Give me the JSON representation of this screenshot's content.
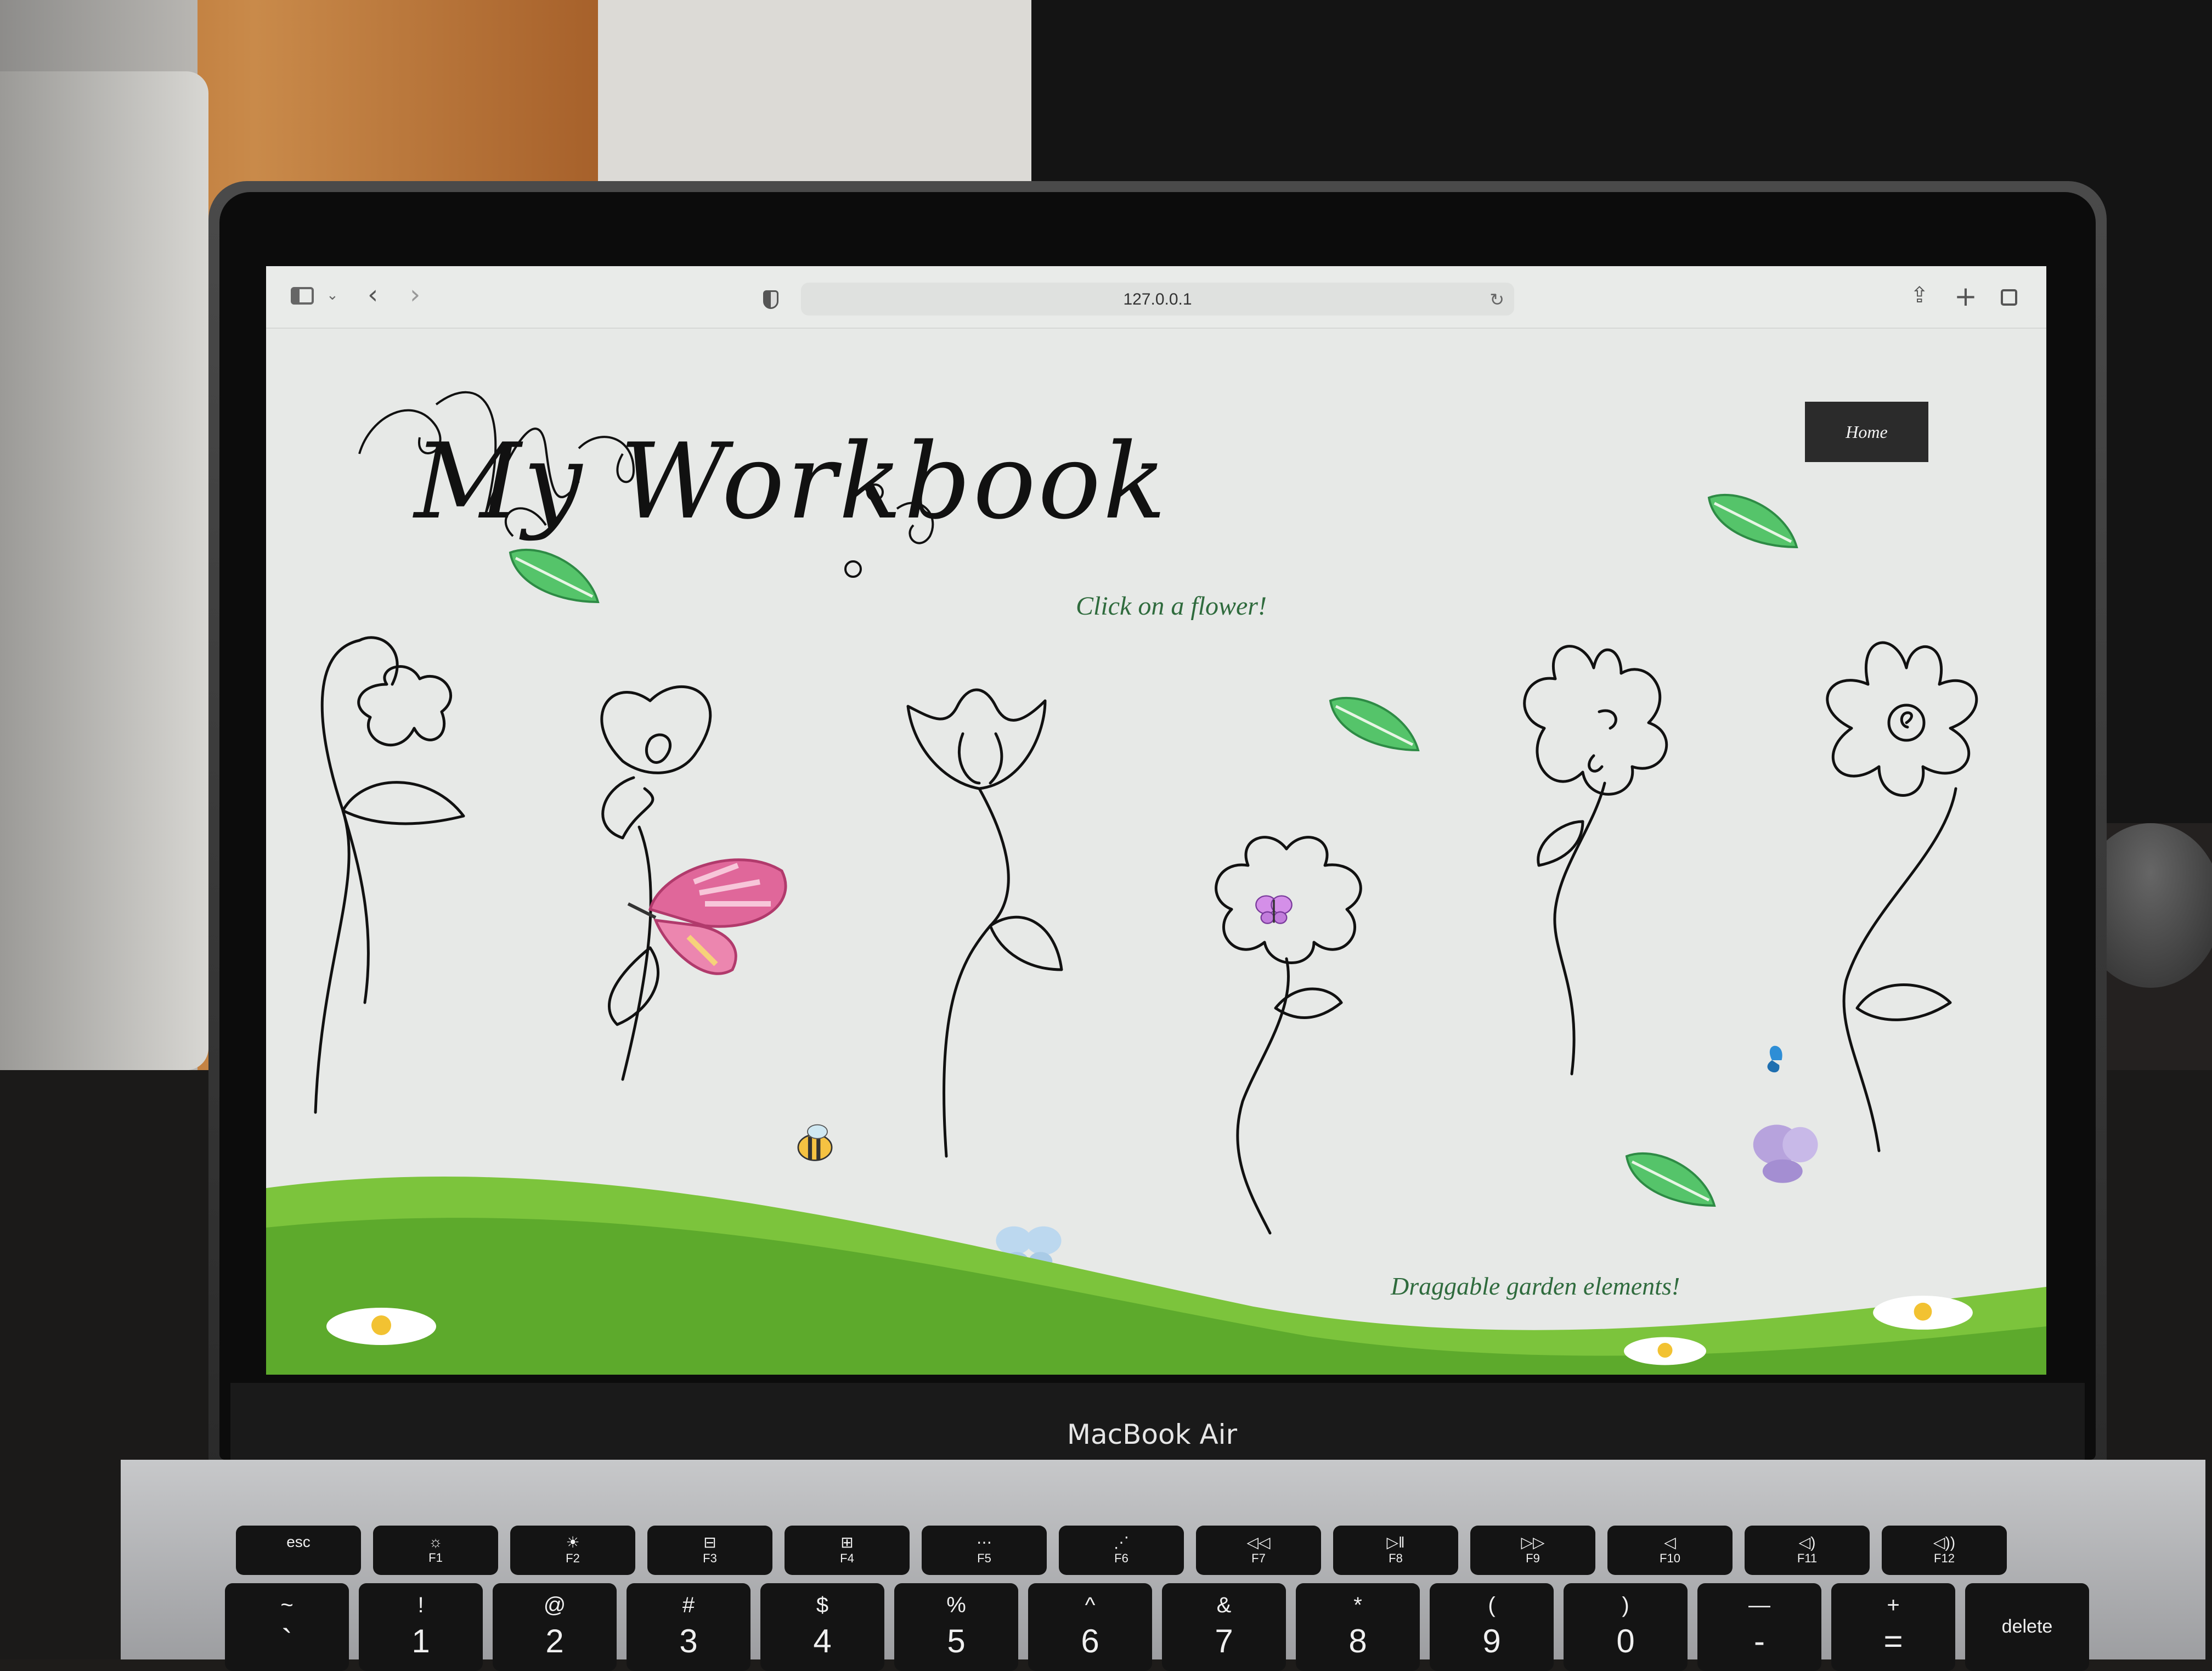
{
  "browser": {
    "url": "127.0.0.1",
    "icons": [
      "sidebar-icon",
      "chevron-down-icon",
      "back-icon",
      "forward-icon",
      "privacy-shield-icon",
      "reload-icon",
      "share-icon",
      "new-tab-icon",
      "tab-overview-icon"
    ]
  },
  "site": {
    "logo_text": "My Workbook",
    "nav_home_label": "Home",
    "instruction_text": "Click on a flower!",
    "footer_caption": "Draggable garden elements!"
  },
  "laptop": {
    "brand_label": "MacBook Air"
  },
  "keyboard": {
    "function_row": [
      {
        "top": "esc",
        "bot": ""
      },
      {
        "top": "☼",
        "bot": "F1"
      },
      {
        "top": "☀",
        "bot": "F2"
      },
      {
        "top": "⊟",
        "bot": "F3"
      },
      {
        "top": "⊞",
        "bot": "F4"
      },
      {
        "top": "⋯",
        "bot": "F5"
      },
      {
        "top": "⋰",
        "bot": "F6"
      },
      {
        "top": "◁◁",
        "bot": "F7"
      },
      {
        "top": "▷‖",
        "bot": "F8"
      },
      {
        "top": "▷▷",
        "bot": "F9"
      },
      {
        "top": "◁",
        "bot": "F10"
      },
      {
        "top": "◁)",
        "bot": "F11"
      },
      {
        "top": "◁))",
        "bot": "F12"
      }
    ],
    "number_row": [
      {
        "top": "~",
        "bot": "`"
      },
      {
        "top": "!",
        "bot": "1"
      },
      {
        "top": "@",
        "bot": "2"
      },
      {
        "top": "#",
        "bot": "3"
      },
      {
        "top": "$",
        "bot": "4"
      },
      {
        "top": "%",
        "bot": "5"
      },
      {
        "top": "^",
        "bot": "6"
      },
      {
        "top": "&",
        "bot": "7"
      },
      {
        "top": "*",
        "bot": "8"
      },
      {
        "top": "(",
        "bot": "9"
      },
      {
        "top": ")",
        "bot": "0"
      },
      {
        "top": "—",
        "bot": "-"
      },
      {
        "top": "+",
        "bot": "="
      },
      {
        "top": "",
        "bot": "delete"
      }
    ]
  },
  "colors": {
    "page_bg": "#e7e9e7",
    "accent_green": "#2f6b3d",
    "hill_green": "#7cc43c",
    "nav_button_bg": "#2b2b2b",
    "butterfly_pink": "#e0679a"
  }
}
